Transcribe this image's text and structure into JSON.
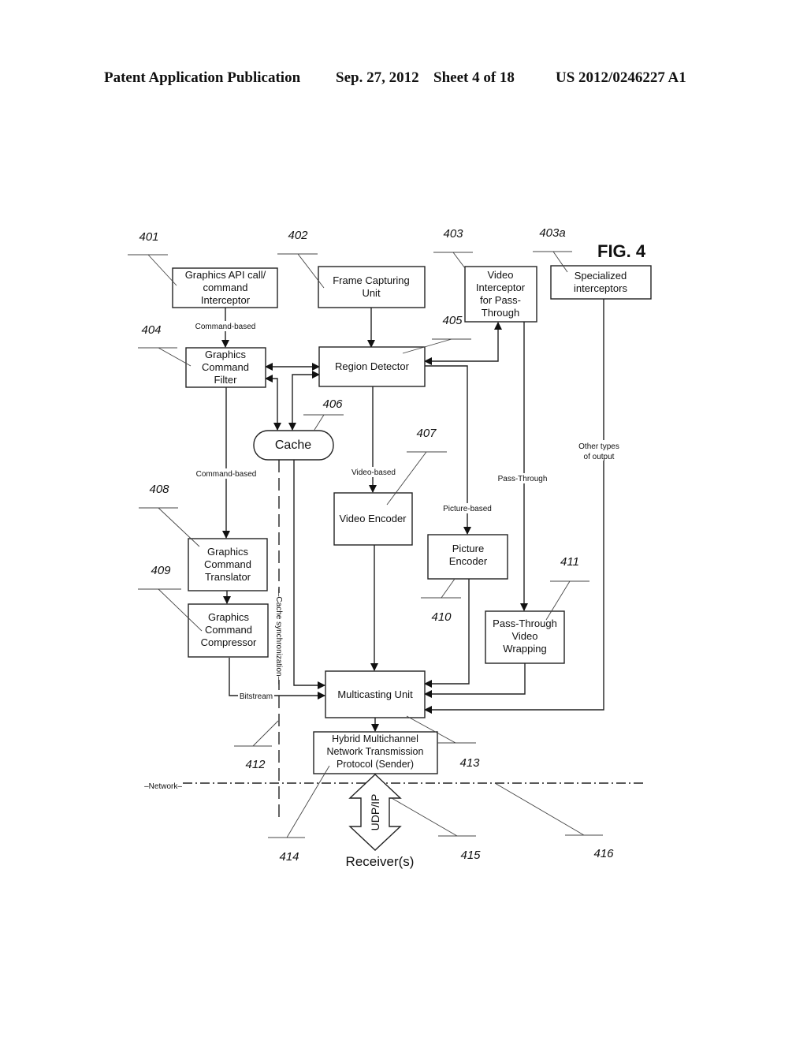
{
  "header": {
    "publication": "Patent Application Publication",
    "date": "Sep. 27, 2012",
    "sheet": "Sheet 4 of 18",
    "number": "US 2012/0246227 A1"
  },
  "figure_label": "FIG. 4",
  "blocks": {
    "b401": {
      "ref": "401",
      "lines": [
        "Graphics API call/",
        "command",
        "Interceptor"
      ]
    },
    "b402": {
      "ref": "402",
      "lines": [
        "Frame Capturing",
        "Unit"
      ]
    },
    "b403": {
      "ref": "403",
      "lines": [
        "Video",
        "Interceptor",
        "for Pass-",
        "Through"
      ]
    },
    "b403a": {
      "ref": "403a",
      "lines": [
        "Specialized",
        "interceptors"
      ]
    },
    "b404": {
      "ref": "404",
      "lines": [
        "Graphics",
        "Command",
        "Filter"
      ]
    },
    "b405": {
      "ref": "405",
      "lines": [
        "Region Detector"
      ]
    },
    "b406": {
      "ref": "406",
      "lines": [
        "Cache"
      ]
    },
    "b407": {
      "ref": "407",
      "lines": [
        "Video Encoder"
      ]
    },
    "b408": {
      "ref": "408",
      "lines": [
        "Graphics",
        "Command",
        "Translator"
      ]
    },
    "b409": {
      "ref": "409",
      "lines": [
        "Graphics",
        "Command",
        "Compressor"
      ]
    },
    "b410": {
      "ref": "410",
      "lines": [
        "Picture",
        "Encoder"
      ]
    },
    "b411": {
      "ref": "411",
      "lines": [
        "Pass-Through",
        "Video",
        "Wrapping"
      ]
    },
    "b413": {
      "ref": "413",
      "lines": [
        "Multicasting Unit"
      ]
    },
    "b414": {
      "ref": "414",
      "lines": [
        "Hybrid Multichannel",
        "Network Transmission",
        "Protocol (Sender)"
      ]
    }
  },
  "refs": {
    "r412": "412",
    "r415": "415",
    "r416": "416"
  },
  "edge_labels": {
    "command_based_1": "Command-based",
    "command_based_2": "Command-based",
    "video_based": "Video-based",
    "picture_based": "Picture-based",
    "pass_through": "Pass-Through",
    "other_types_1": "Other types",
    "other_types_2": "of output",
    "bitstream": "Bitstream",
    "cache_sync": "Cache synchronization",
    "network": "Network",
    "udp_ip": "UDP/IP",
    "receivers": "Receiver(s)"
  }
}
